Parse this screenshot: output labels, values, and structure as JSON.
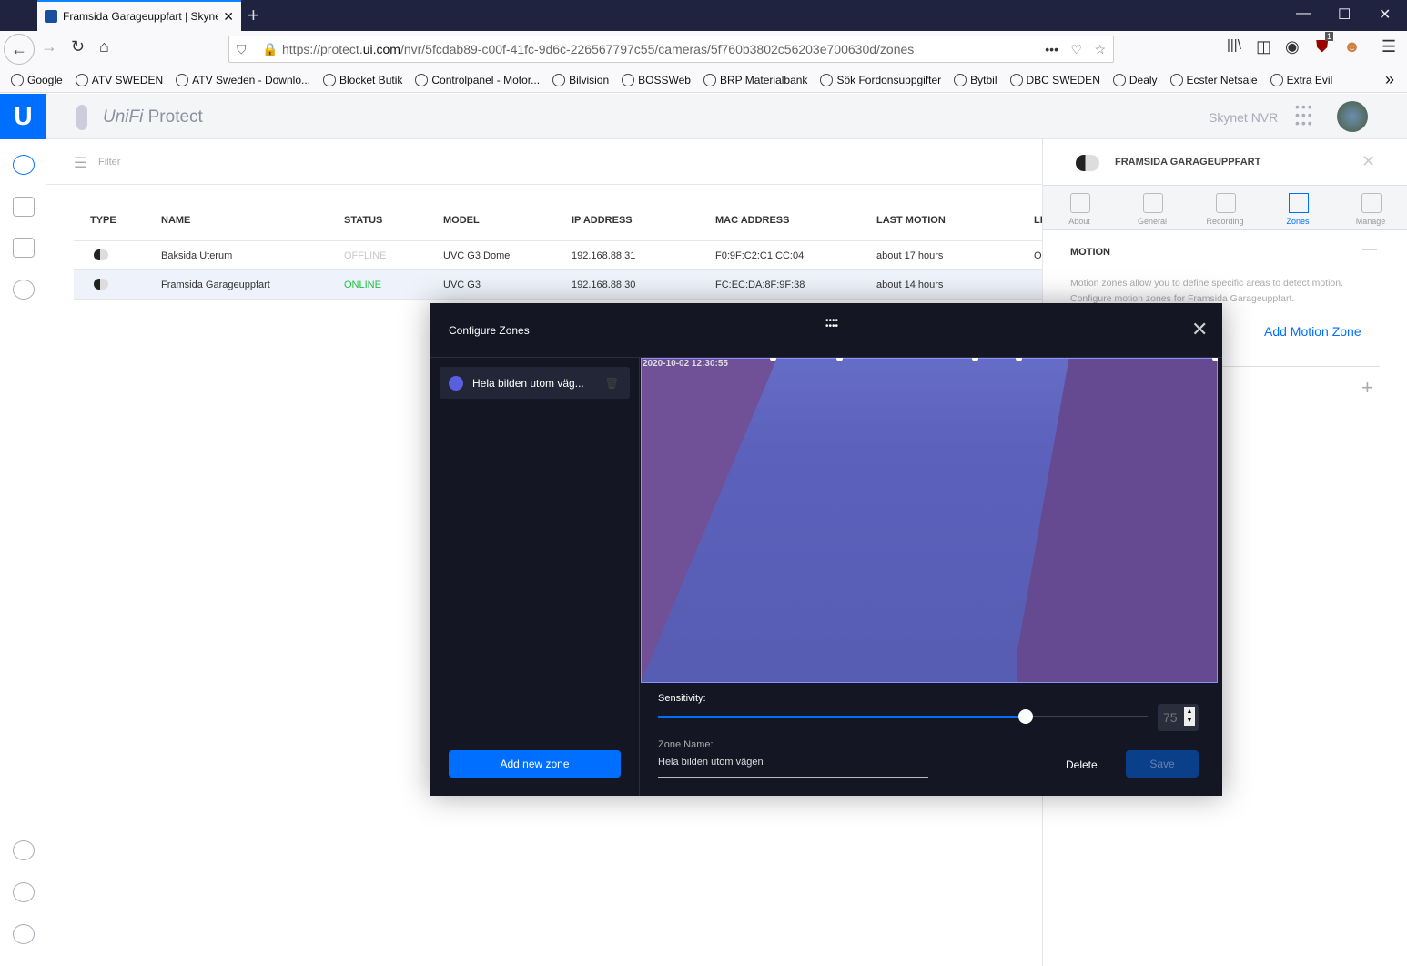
{
  "browser": {
    "tab_title": "Framsida Garageuppfart | Skynet NVR",
    "url_prefix": "https://protect.",
    "url_domain": "ui.com",
    "url_path": "/nvr/5fcdab89-c00f-41fc-9d6c-226567797c55/cameras/5f760b3802c56203e700630d/zones",
    "ublock_count": "1",
    "bookmarks": [
      "Google",
      "ATV SWEDEN",
      "ATV Sweden - Downlo...",
      "Blocket Butik",
      "Controlpanel - Motor...",
      "Bilvision",
      "BOSSWeb",
      "BRP Materialbank",
      "Sök Fordonsuppgifter",
      "Bytbil",
      "DBC SWEDEN",
      "Dealy",
      "Ecster Netsale",
      "Extra Evil"
    ]
  },
  "app": {
    "name_brand": "UniFi",
    "name_product": "Protect",
    "nvr_name": "Skynet NVR",
    "filter_placeholder": "Filter"
  },
  "table": {
    "headers": [
      "TYPE",
      "NAME",
      "STATUS",
      "MODEL",
      "IP ADDRESS",
      "MAC ADDRESS",
      "LAST MOTION",
      "LI"
    ],
    "rows": [
      {
        "name": "Baksida Uterum",
        "status": "OFFLINE",
        "model": "UVC G3 Dome",
        "ip": "192.168.88.31",
        "mac": "F0:9F:C2:C1:CC:04",
        "last_motion": "about 17 hours",
        "extra": "O"
      },
      {
        "name": "Framsida Garageuppfart",
        "status": "ONLINE",
        "model": "UVC G3",
        "ip": "192.168.88.30",
        "mac": "FC:EC:DA:8F:9F:38",
        "last_motion": "about 14 hours",
        "extra": ""
      }
    ]
  },
  "side": {
    "title": "FRAMSIDA GARAGEUPPFART",
    "tabs": [
      "About",
      "General",
      "Recording",
      "Zones",
      "Manage"
    ],
    "active_tab": "Zones",
    "section": "MOTION",
    "description1": "Motion zones allow you to define specific areas to detect motion.",
    "description2": "Configure motion zones for Framsida Garageuppfart.",
    "add_zone": "Add Motion Zone"
  },
  "modal": {
    "title": "Configure Zones",
    "zone_item": "Hela bilden utom väg...",
    "add_new": "Add new zone",
    "timestamp": "2020-10-02 12:30:55",
    "sensitivity_label": "Sensitivity:",
    "sensitivity": 75,
    "sensitivity_text": "75",
    "zone_name_label": "Zone Name:",
    "zone_name": "Hela bilden utom vägen",
    "delete": "Delete",
    "save": "Save"
  },
  "colors": {
    "accent": "#006fff",
    "online": "#20c040",
    "offline": "#c8c8c8",
    "zone": "#5a5fe0"
  }
}
